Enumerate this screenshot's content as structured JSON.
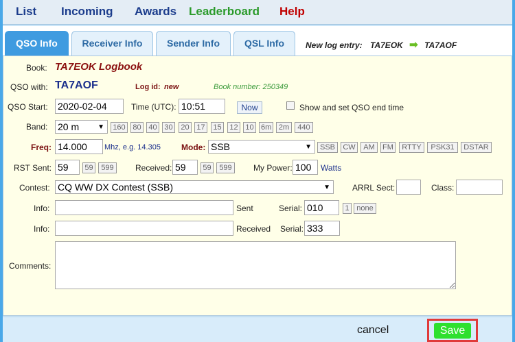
{
  "nav": {
    "list": "List",
    "incoming": "Incoming",
    "awards": "Awards",
    "leaderboard": "Leaderboard",
    "help": "Help"
  },
  "tabs": {
    "qso": "QSO Info",
    "receiver": "Receiver Info",
    "sender": "Sender Info",
    "qsl": "QSL Info"
  },
  "new_log": {
    "label": "New log entry:",
    "from": "TA7EOK",
    "to": "TA7AOF"
  },
  "form": {
    "book_label": "Book:",
    "book_value": "TA7EOK Logbook",
    "qso_with_label": "QSO with:",
    "qso_with_value": "TA7AOF",
    "log_id_label": "Log id:",
    "log_id_value": "new",
    "book_number": "Book number: 250349",
    "qso_start_label": "QSO Start:",
    "qso_start_value": "2020-02-04",
    "time_label": "Time (UTC):",
    "time_value": "10:51",
    "now_button": "Now",
    "show_end_label": "Show and set QSO end time",
    "band_label": "Band:",
    "band_value": "20 m",
    "band_quick": [
      "160",
      "80",
      "40",
      "30",
      "20",
      "17",
      "15",
      "12",
      "10",
      "6m",
      "2m",
      "440"
    ],
    "freq_label": "Freq:",
    "freq_value": "14.000",
    "freq_hint": "Mhz, e.g. 14.305",
    "mode_label": "Mode:",
    "mode_value": "SSB",
    "mode_quick": [
      "SSB",
      "CW",
      "AM",
      "FM",
      "RTTY",
      "PSK31",
      "DSTAR"
    ],
    "rst_sent_label": "RST Sent:",
    "rst_sent_value": "59",
    "rst_sent_quick": [
      "59",
      "599"
    ],
    "received_label": "Received:",
    "received_value": "59",
    "received_quick": [
      "59",
      "599"
    ],
    "power_label": "My Power:",
    "power_value": "100",
    "power_unit": "Watts",
    "contest_label": "Contest:",
    "contest_value": "CQ WW DX Contest (SSB)",
    "arrl_label": "ARRL Sect:",
    "arrl_value": "",
    "class_label": "Class:",
    "class_value": "",
    "info1_label": "Info:",
    "info1_value": "",
    "sent_label": "Sent",
    "serial1_label": "Serial:",
    "serial1_value": "010",
    "serial1_quick": [
      "1",
      "none"
    ],
    "info2_label": "Info:",
    "info2_value": "",
    "received2_label": "Received",
    "serial2_label": "Serial:",
    "serial2_value": "333",
    "comments_label": "Comments:",
    "comments_value": ""
  },
  "footer": {
    "cancel": "cancel",
    "save": "Save"
  },
  "colors": {
    "nav_blue": "#1b3c8c",
    "nav_green": "#2a9a2a",
    "nav_red": "#c00000",
    "tab_active": "#3f9be0",
    "panel_bg": "#ffffe8",
    "save_green": "#2ee02e",
    "highlight_red": "#e03a3a"
  },
  "icons": {
    "arrow": "arrow-right-icon",
    "caret": "chevron-down-icon",
    "resize": "resize-grip-icon"
  }
}
